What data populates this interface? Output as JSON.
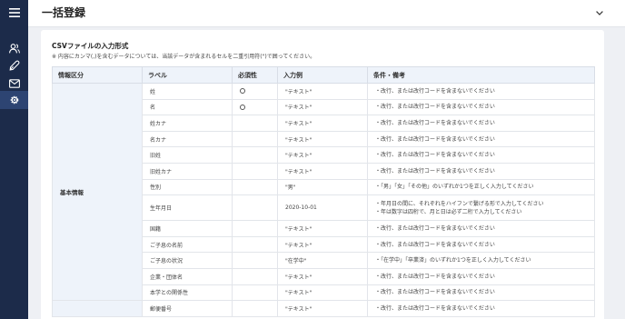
{
  "header": {
    "title": "一括登録"
  },
  "sidebar": {
    "icons": [
      "menu-icon",
      "users-icon",
      "pen-icon",
      "mail-icon",
      "gear-icon"
    ]
  },
  "section": {
    "title": "CSVファイルの入力形式",
    "note": "※ 内容にカンマ(,)を含むデータについては、当該データが含まれるセルを二重引用符(\")で囲ってください。"
  },
  "table": {
    "headers": [
      "情報区分",
      "ラベル",
      "必須性",
      "入力例",
      "条件・備考"
    ],
    "category": "基本情報",
    "required_mark": "◯",
    "rows": [
      {
        "label": "姓",
        "required": true,
        "example": "\"テキスト\"",
        "conditions": [
          "・改行、または改行コードを含まないでください"
        ]
      },
      {
        "label": "名",
        "required": true,
        "example": "\"テキスト\"",
        "conditions": [
          "・改行、または改行コードを含まないでください"
        ]
      },
      {
        "label": "姓カナ",
        "required": false,
        "example": "\"テキスト\"",
        "conditions": [
          "・改行、または改行コードを含まないでください"
        ]
      },
      {
        "label": "名カナ",
        "required": false,
        "example": "\"テキスト\"",
        "conditions": [
          "・改行、または改行コードを含まないでください"
        ]
      },
      {
        "label": "旧姓",
        "required": false,
        "example": "\"テキスト\"",
        "conditions": [
          "・改行、または改行コードを含まないでください"
        ]
      },
      {
        "label": "旧姓カナ",
        "required": false,
        "example": "\"テキスト\"",
        "conditions": [
          "・改行、または改行コードを含まないでください"
        ]
      },
      {
        "label": "性別",
        "required": false,
        "example": "\"男\"",
        "conditions": [
          "・「男」「女」「その他」のいずれか1つを正しく入力してください"
        ]
      },
      {
        "label": "生年月日",
        "required": false,
        "example": "2020-10-01",
        "conditions": [
          "・年月日の間に、それぞれをハイフンで繋げる形で入力してください",
          "・年は数字は四桁で、月と日は必ず二桁で入力してください"
        ]
      },
      {
        "label": "国籍",
        "required": false,
        "example": "\"テキスト\"",
        "conditions": [
          "・改行、または改行コードを含まないでください"
        ]
      },
      {
        "label": "ご子息の名前",
        "required": false,
        "example": "\"テキスト\"",
        "conditions": [
          "・改行、または改行コードを含まないでください"
        ]
      },
      {
        "label": "ご子息の状況",
        "required": false,
        "example": "\"在学中\"",
        "conditions": [
          "・「在学中」「卒業済」のいずれか1つを正しく入力してください"
        ]
      },
      {
        "label": "企業・団体名",
        "required": false,
        "example": "\"テキスト\"",
        "conditions": [
          "・改行、または改行コードを含まないでください"
        ]
      },
      {
        "label": "本学との関係性",
        "required": false,
        "example": "\"テキスト\"",
        "conditions": [
          "・改行、または改行コードを含まないでください"
        ]
      },
      {
        "label": "郵便番号",
        "required": false,
        "example": "\"テキスト\"",
        "conditions": [
          "・改行、または改行コードを含まないでください"
        ]
      }
    ]
  }
}
